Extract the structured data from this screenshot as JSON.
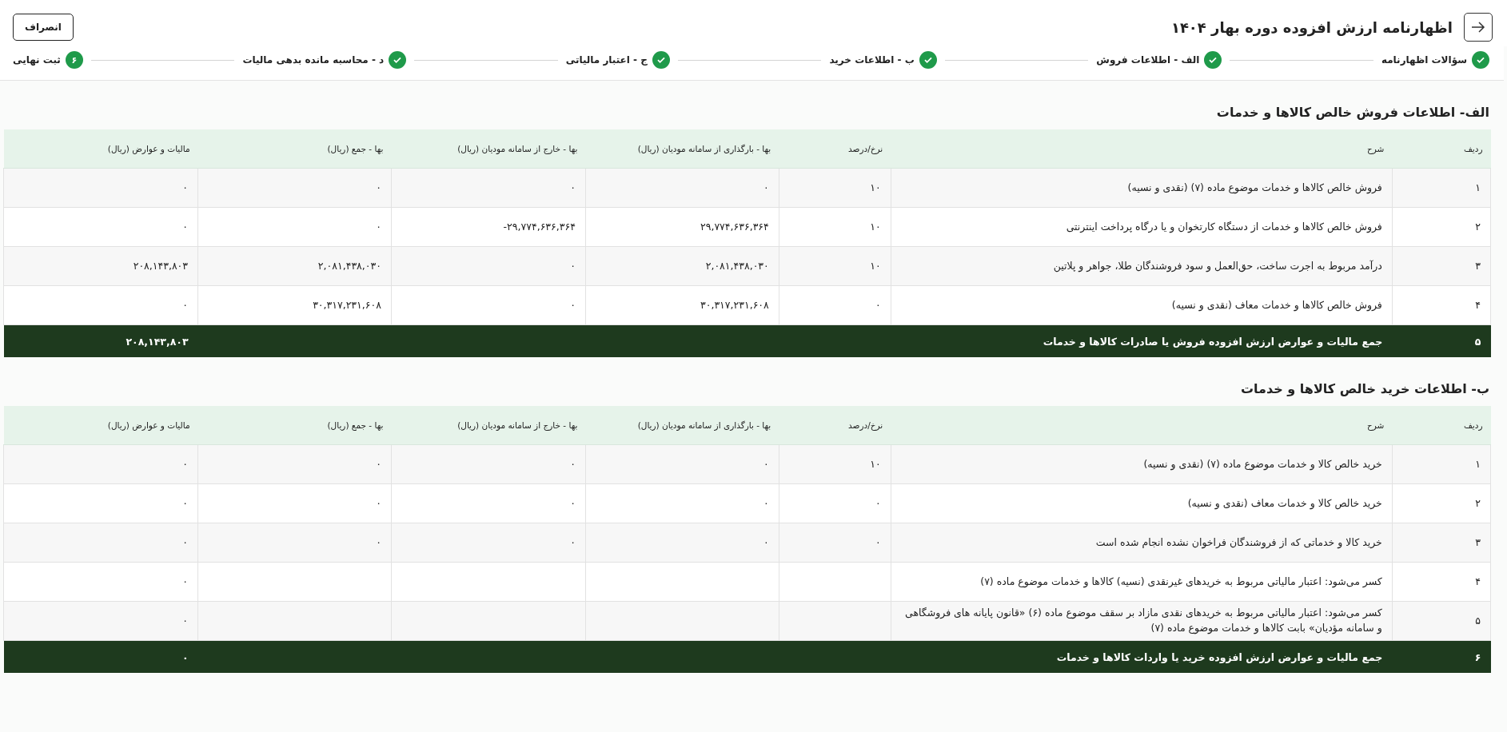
{
  "header": {
    "title": "اظهارنامه ارزش افزوده دوره بهار ۱۴۰۴",
    "cancel_button": "انصراف"
  },
  "steps": [
    {
      "label": "سؤالات اظهارنامه",
      "completed": true
    },
    {
      "label": "الف - اطلاعات فروش",
      "completed": true
    },
    {
      "label": "ب - اطلاعات خرید",
      "completed": true
    },
    {
      "label": "ج - اعتبار مالیاتی",
      "completed": true
    },
    {
      "label": "د - محاسبه مانده بدهی مالیات",
      "completed": true
    },
    {
      "label": "ثبت نهایی",
      "completed": false,
      "number": "۶"
    }
  ],
  "sections": [
    {
      "title": "الف- اطلاعات فروش خالص کالاها و خدمات",
      "columns": [
        "ردیف",
        "شرح",
        "نرخ/درصد",
        "بها - بارگذاری از سامانه مودیان (ریال)",
        "بها - خارج از سامانه مودیان (ریال)",
        "بها - جمع (ریال)",
        "مالیات و عوارض (ریال)"
      ],
      "rows": [
        {
          "cells": [
            "۱",
            "فروش خالص کالاها و خدمات موضوع ماده (۷) (نقدی و نسیه)",
            "۱۰",
            "۰",
            "۰",
            "۰",
            "۰"
          ]
        },
        {
          "cells": [
            "۲",
            "فروش خالص کالاها و خدمات از دستگاه کارتخوان و یا درگاه پرداخت اینترنتی",
            "۱۰",
            "۲۹,۷۷۴,۶۳۶,۳۶۴",
            "-۲۹,۷۷۴,۶۳۶,۳۶۴",
            "۰",
            "۰"
          ]
        },
        {
          "cells": [
            "۳",
            "درآمد مربوط به اجرت ساخت، حق‌العمل و سود فروشندگان طلا، جواهر و پلاتین",
            "۱۰",
            "۲,۰۸۱,۴۳۸,۰۳۰",
            "۰",
            "۲,۰۸۱,۴۳۸,۰۳۰",
            "۲۰۸,۱۴۳,۸۰۳"
          ]
        },
        {
          "cells": [
            "۴",
            "فروش خالص کالاها و خدمات معاف (نقدی و نسیه)",
            "۰",
            "۳۰,۳۱۷,۲۳۱,۶۰۸",
            "۰",
            "۳۰,۳۱۷,۲۳۱,۶۰۸",
            "۰"
          ]
        }
      ],
      "total": {
        "number": "۵",
        "label": "جمع مالیات و عوارض ارزش افزوده فروش یا صادرات کالاها و خدمات",
        "value": "۲۰۸,۱۴۳,۸۰۳"
      }
    },
    {
      "title": "ب- اطلاعات خرید خالص کالاها و خدمات",
      "columns": [
        "ردیف",
        "شرح",
        "نرخ/درصد",
        "بها - بارگذاری از سامانه مودیان (ریال)",
        "بها - خارج از سامانه مودیان (ریال)",
        "بها - جمع (ریال)",
        "مالیات و عوارض (ریال)"
      ],
      "rows": [
        {
          "cells": [
            "۱",
            "خرید خالص کالا و خدمات موضوع ماده (۷) (نقدی و نسیه)",
            "۱۰",
            "۰",
            "۰",
            "۰",
            "۰"
          ]
        },
        {
          "cells": [
            "۲",
            "خرید خالص کالا و خدمات معاف (نقدی و نسیه)",
            "۰",
            "۰",
            "۰",
            "۰",
            "۰"
          ]
        },
        {
          "cells": [
            "۳",
            "خرید کالا و خدماتی که از فروشندگان فراخوان نشده انجام شده است",
            "۰",
            "۰",
            "۰",
            "۰",
            "۰"
          ]
        },
        {
          "cells": [
            "۴",
            "کسر می‌شود: اعتبار مالیاتی مربوط به خریدهای غیرنقدی (نسیه) کالاها و خدمات موضوع ماده (۷)",
            null,
            null,
            null,
            null,
            "۰"
          ]
        },
        {
          "cells": [
            "۵",
            "کسر می‌شود: اعتبار مالیاتی مربوط به خریدهای نقدی مازاد بر سقف موضوع ماده (۶) «قانون پایانه های فروشگاهی و سامانه مؤدیان» بابت کالاها و خدمات موضوع ماده (۷)",
            null,
            null,
            null,
            null,
            "۰"
          ]
        }
      ],
      "total": {
        "number": "۶",
        "label": "جمع مالیات و عوارض ارزش افزوده خرید یا واردات کالاها و خدمات",
        "value": "۰"
      }
    }
  ]
}
